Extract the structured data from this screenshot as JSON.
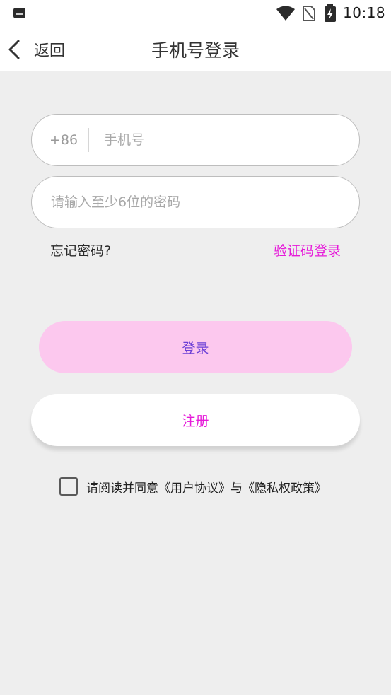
{
  "status_bar": {
    "time": "10:18",
    "icons": [
      "app-notification-icon",
      "wifi-icon",
      "no-sim-icon",
      "battery-charging-icon"
    ]
  },
  "header": {
    "back_label": "返回",
    "title": "手机号登录"
  },
  "phone_field": {
    "country_code": "+86",
    "placeholder": "手机号",
    "value": ""
  },
  "password_field": {
    "placeholder": "请输入至少6位的密码",
    "value": ""
  },
  "links": {
    "forgot_password": "忘记密码?",
    "code_login": "验证码登录"
  },
  "buttons": {
    "login": "登录",
    "register": "注册"
  },
  "agreement": {
    "prefix": "请阅读并同意《",
    "user_agreement": "用户协议",
    "middle": "》与《",
    "privacy_policy": "隐私权政策",
    "suffix": "》",
    "checked": false
  },
  "colors": {
    "accent": "#e619d9",
    "login_button_bg": "#fcc8ee",
    "login_button_text": "#6b3fd6",
    "background": "#eeeeee"
  }
}
